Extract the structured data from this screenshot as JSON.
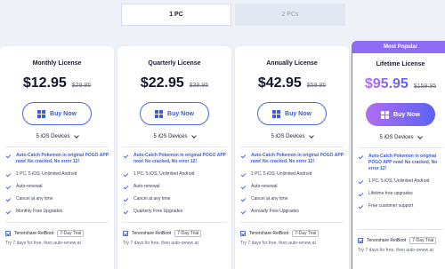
{
  "tabs": [
    {
      "label": "1 PC"
    },
    {
      "label": "2 PCs"
    }
  ],
  "cards": [
    {
      "name": "Monthly License",
      "price": "$12.95",
      "old_price": "$29.95",
      "buy": "Buy Now",
      "devices": "5 iOS Devices",
      "features": [
        "Auto-Catch Pokemon in original POGO APP now! No cracked, No error 12!",
        "1 PC, 5 iOS, Unlimited Android",
        "Auto-renewal",
        "Cancel at any time",
        "Monthly Free Upgrades"
      ],
      "addon": "Tenorshare ReiBoot",
      "trial": "7-Day Trial",
      "addon_note": "Try 7 days for free, then auto-renew at"
    },
    {
      "name": "Quarterly License",
      "price": "$22.95",
      "old_price": "$39.95",
      "buy": "Buy Now",
      "devices": "5 iOS Devices",
      "features": [
        "Auto-Catch Pokemon in original POGO APP now! No cracked, No error 12!",
        "1 PC, 5 iOS, Unlimited Android",
        "Auto-renewal",
        "Cancel at any time",
        "Quarterly Free Upgrades"
      ],
      "addon": "Tenorshare ReiBoot",
      "trial": "7-Day Trial",
      "addon_note": "Try 7 days for free, then auto-renew at"
    },
    {
      "name": "Annually License",
      "price": "$42.95",
      "old_price": "$59.95",
      "buy": "Buy Now",
      "devices": "5 iOS Devices",
      "features": [
        "Auto-Catch Pokemon in original POGO APP now! No cracked, No error 12!",
        "1 PC, 5 iOS, Unlimited Android",
        "Auto-renewal",
        "Cancel at any time",
        "Annually Free Upgrades"
      ],
      "addon": "Tenorshare ReiBoot",
      "trial": "7-Day Trial",
      "addon_note": "Try 7 days for free, then auto-renew at"
    },
    {
      "badge": "Most Popular",
      "name": "Lifetime License",
      "price": "$95.95",
      "old_price": "$159.95",
      "buy": "Buy Now",
      "devices": "5 iOS Devices",
      "features": [
        "Auto-Catch Pokemon in original POGO APP now! No cracked, No error 12!",
        "1 PC, 5 iOS, Unlimited Android",
        "Lifetime free upgrades",
        "Free customer support"
      ],
      "addon": "Tenorshare ReiBoot",
      "trial": "7-Day Trial",
      "addon_note": "Try 7 days for free, then auto-renew at"
    }
  ],
  "colors": {
    "accent": "#4a6ae8",
    "featured": "#8e6df5",
    "background": "#eef1f8"
  },
  "icons": [
    "windows-icon",
    "chevron-down-icon",
    "check-icon",
    "checkbox-icon"
  ]
}
